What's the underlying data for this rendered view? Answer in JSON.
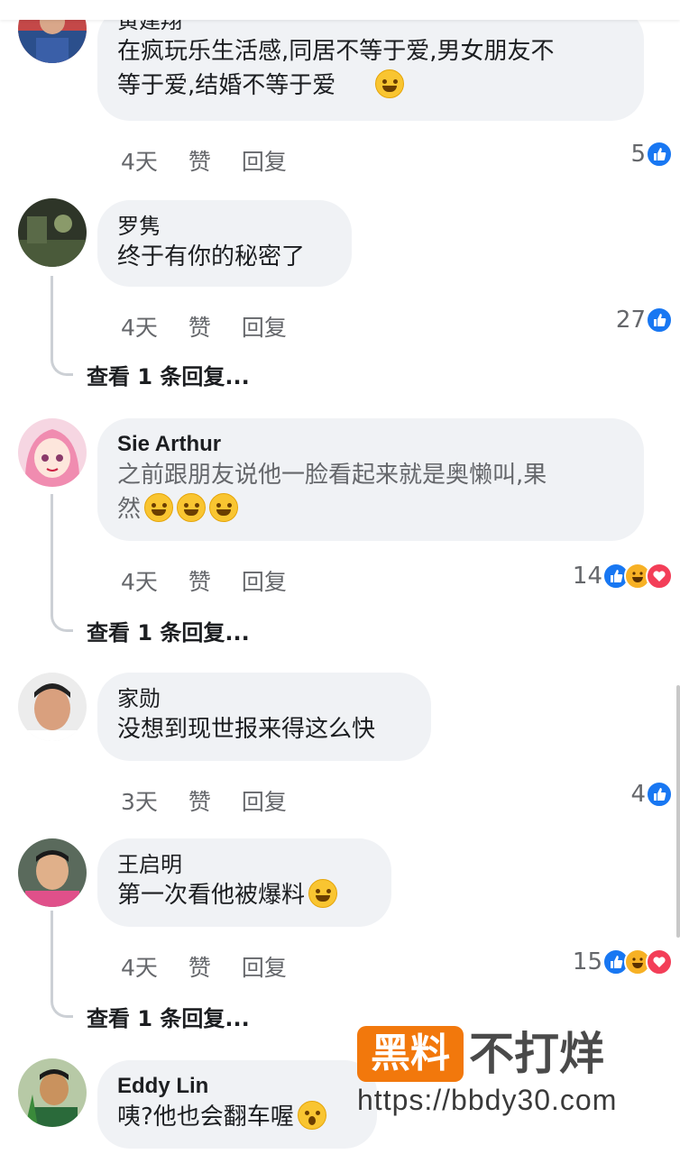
{
  "comments": [
    {
      "author": "黄建翔",
      "lines": [
        "在疯玩乐生活感,同居不等于爱,男女朋友不",
        "等于爱,结婚不等于爱"
      ],
      "time": "4天",
      "like": "赞",
      "reply": "回复",
      "count": "5"
    },
    {
      "author": "罗隽",
      "lines": [
        "终于有你的秘密了"
      ],
      "time": "4天",
      "like": "赞",
      "reply": "回复",
      "count": "27",
      "view_replies": "查看 1 条回复..."
    },
    {
      "author": "Sie Arthur",
      "lines": [
        "之前跟朋友说他一脸看起来就是奥懒叫,果",
        "然"
      ],
      "time": "4天",
      "like": "赞",
      "reply": "回复",
      "count": "14",
      "view_replies": "查看 1 条回复..."
    },
    {
      "author": "家勋",
      "lines": [
        "没想到现世报来得这么快"
      ],
      "time": "3天",
      "like": "赞",
      "reply": "回复",
      "count": "4"
    },
    {
      "author": "王启明",
      "lines": [
        "第一次看他被爆料"
      ],
      "time": "4天",
      "like": "赞",
      "reply": "回复",
      "count": "15",
      "view_replies": "查看 1 条回复..."
    },
    {
      "author": "Eddy Lin",
      "lines": [
        "咦?他也会翻车喔"
      ]
    }
  ],
  "watermark": {
    "badge": "黑料",
    "main": "不打烊",
    "url": "https://bbdy30.com"
  },
  "colors": {
    "like": "#1877f2",
    "haha": "#f7b125",
    "love": "#f33e58",
    "bubble": "#f0f2f5"
  }
}
